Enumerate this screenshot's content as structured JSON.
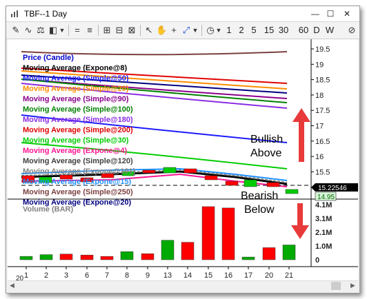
{
  "window": {
    "title": "TBF--1 Day",
    "minimize_glyph": "—",
    "maximize_glyph": "☐",
    "close_glyph": "✕"
  },
  "toolbar": {
    "periods": [
      "1",
      "2",
      "5",
      "15",
      "30",
      "60",
      "D",
      "W"
    ]
  },
  "price_panel": {
    "legend": [
      {
        "label": "Price (Candle)",
        "color": "#0000cc"
      },
      {
        "label": "Moving Average (Expone@8)",
        "color": "#000000"
      },
      {
        "label": "Moving Average (Simple@50)",
        "color": "#1a1aff"
      },
      {
        "label": "Moving Average (Simple@20)",
        "color": "#ff8c00"
      },
      {
        "label": "Moving Average (Simple@90)",
        "color": "#8b008b"
      },
      {
        "label": "Moving Average (Simple@100)",
        "color": "#008000"
      },
      {
        "label": "Moving Average (Simple@180)",
        "color": "#8a2be2"
      },
      {
        "label": "Moving Average (Simple@200)",
        "color": "#e00000"
      },
      {
        "label": "Moving Average (Simple@30)",
        "color": "#00cc00"
      },
      {
        "label": "Moving Average (Expone@4)",
        "color": "#ff1493"
      },
      {
        "label": "Moving Average (Simple@120)",
        "color": "#404040"
      },
      {
        "label": "Moving Average (Expone@101)",
        "color": "#808080"
      },
      {
        "label": "Moving Average (Expone@15)",
        "color": "#1e90ff"
      },
      {
        "label": "Moving Average (Simple@250)",
        "color": "#7b3f3f"
      },
      {
        "label": "Moving Average (Expone@20)",
        "color": "#000080"
      }
    ],
    "y_ticks": [
      "19.5",
      "19",
      "18.5",
      "18",
      "17.5",
      "17",
      "16.5",
      "16",
      "15.5",
      "15"
    ],
    "last_price_label": "15.22546",
    "second_price_label": "14.95",
    "annotation_bullish": "Bullish\nAbove",
    "annotation_bearish": "Bearish\nBelow",
    "arrow_color": "#e83a3a"
  },
  "volume_panel": {
    "title": "Volume (BAR)",
    "y_ticks": [
      "4.1M",
      "3.1M",
      "2.1M",
      "1.0M",
      "0"
    ]
  },
  "chart_data": {
    "type": "bar",
    "title": "Volume (BAR)",
    "categories": [
      "1",
      "2",
      "3",
      "6",
      "7",
      "8",
      "9",
      "13",
      "14",
      "15",
      "16",
      "17",
      "20",
      "21"
    ],
    "series": [
      {
        "name": "Volume (BAR)",
        "values": [
          0.25,
          0.38,
          0.42,
          0.35,
          0.25,
          0.6,
          0.45,
          1.45,
          1.3,
          3.95,
          3.85,
          0.2,
          0.9,
          1.1
        ]
      }
    ],
    "colors": [
      "#00aa00",
      "#00aa00",
      "#ff0000",
      "#ff0000",
      "#ff0000",
      "#00aa00",
      "#ff0000",
      "#00aa00",
      "#ff0000",
      "#ff0000",
      "#ff0000",
      "#00aa00",
      "#ff0000",
      "#00aa00"
    ],
    "ylim": [
      0,
      4.1
    ],
    "month_label": "20"
  }
}
